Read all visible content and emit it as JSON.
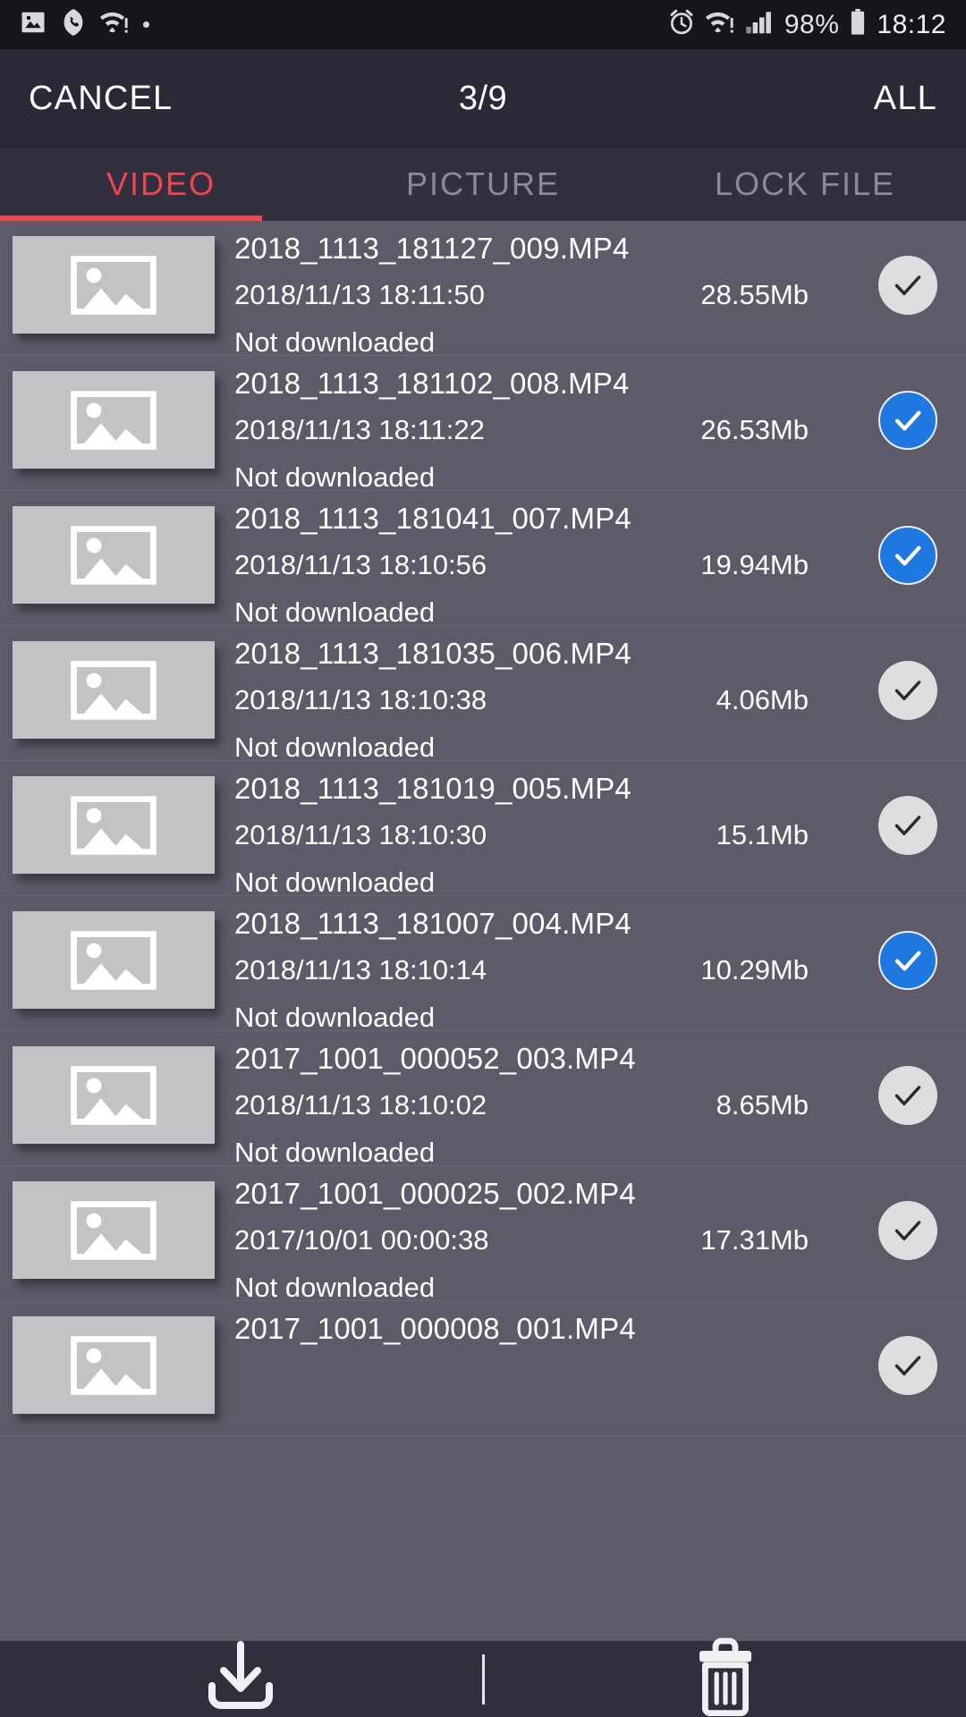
{
  "statusbar": {
    "left_icons": [
      "image-icon",
      "phone-incoming-icon",
      "wifi-alert-icon",
      "dot-icon"
    ],
    "right_icons": [
      "alarm-icon",
      "wifi-alert-icon",
      "signal-icon",
      "battery-icon"
    ],
    "battery_percent": "98%",
    "clock": "18:12"
  },
  "header": {
    "cancel_label": "CANCEL",
    "counter": "3/9",
    "all_label": "ALL"
  },
  "tabs": [
    {
      "label": "VIDEO",
      "active": true
    },
    {
      "label": "PICTURE",
      "active": false
    },
    {
      "label": "LOCK FILE",
      "active": false
    }
  ],
  "colors": {
    "accent": "#e8484e",
    "checked": "#1e78e0",
    "unchecked": "#dededf",
    "header_bg": "#2c2937",
    "tabbar_bg": "#342f3e",
    "list_bg": "#5f5a68",
    "bottombar_bg": "#322e3c"
  },
  "files": [
    {
      "name": "2018_1113_181127_009.MP4",
      "date": "2018/11/13 18:11:50",
      "size": "28.55Mb",
      "status": "Not downloaded",
      "selected": false
    },
    {
      "name": "2018_1113_181102_008.MP4",
      "date": "2018/11/13 18:11:22",
      "size": "26.53Mb",
      "status": "Not downloaded",
      "selected": true
    },
    {
      "name": "2018_1113_181041_007.MP4",
      "date": "2018/11/13 18:10:56",
      "size": "19.94Mb",
      "status": "Not downloaded",
      "selected": true
    },
    {
      "name": "2018_1113_181035_006.MP4",
      "date": "2018/11/13 18:10:38",
      "size": "4.06Mb",
      "status": "Not downloaded",
      "selected": false
    },
    {
      "name": "2018_1113_181019_005.MP4",
      "date": "2018/11/13 18:10:30",
      "size": "15.1Mb",
      "status": "Not downloaded",
      "selected": false
    },
    {
      "name": "2018_1113_181007_004.MP4",
      "date": "2018/11/13 18:10:14",
      "size": "10.29Mb",
      "status": "Not downloaded",
      "selected": true
    },
    {
      "name": "2017_1001_000052_003.MP4",
      "date": "2018/11/13 18:10:02",
      "size": "8.65Mb",
      "status": "Not downloaded",
      "selected": false
    },
    {
      "name": "2017_1001_000025_002.MP4",
      "date": "2017/10/01 00:00:38",
      "size": "17.31Mb",
      "status": "Not downloaded",
      "selected": false
    },
    {
      "name": "2017_1001_000008_001.MP4",
      "date": "",
      "size": "",
      "status": "",
      "selected": false
    }
  ],
  "bottombar": {
    "download_icon": "download-icon",
    "delete_icon": "trash-icon"
  }
}
